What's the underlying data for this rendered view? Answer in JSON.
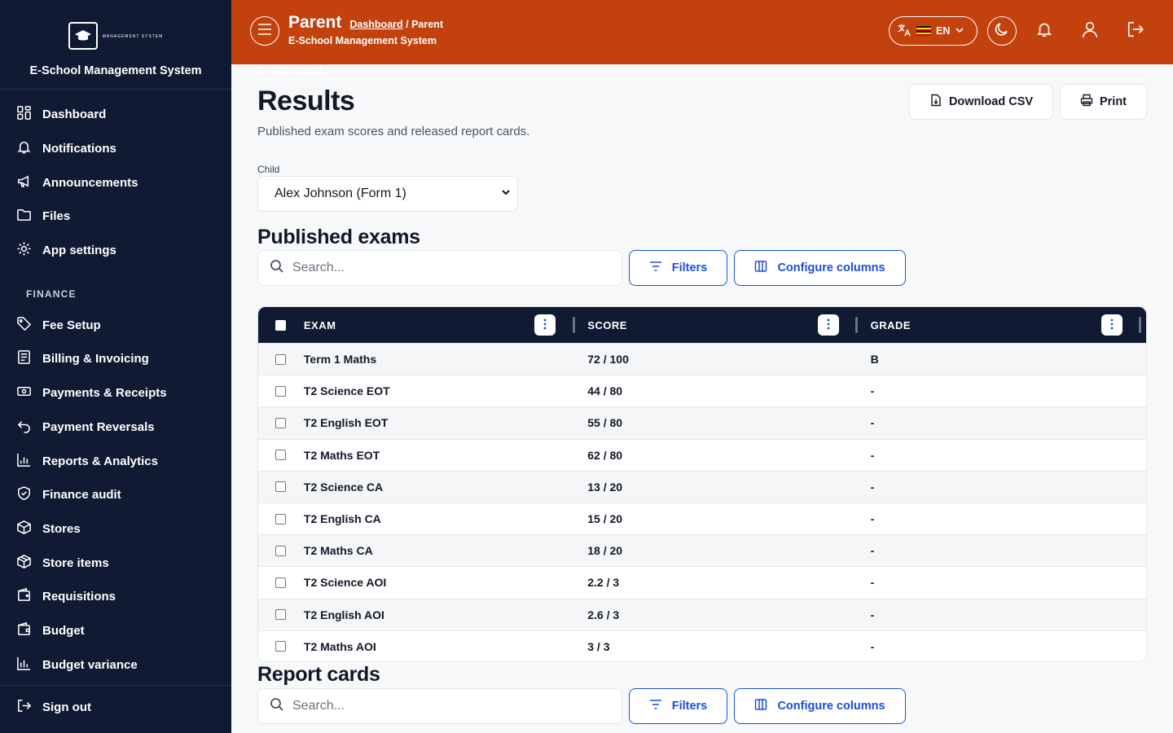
{
  "sidebar": {
    "logo_main": "E-SCHOOL",
    "logo_sub": "MANAGEMENT SYSTEM",
    "brand": "E-School Management System",
    "items": [
      {
        "label": "Dashboard",
        "icon": "grid-icon"
      },
      {
        "label": "Notifications",
        "icon": "bell-icon"
      },
      {
        "label": "Announcements",
        "icon": "megaphone-icon"
      },
      {
        "label": "Files",
        "icon": "folder-icon"
      },
      {
        "label": "App settings",
        "icon": "gear-icon"
      }
    ],
    "finance_heading": "FINANCE",
    "finance_items": [
      {
        "label": "Fee Setup",
        "icon": "tag-icon"
      },
      {
        "label": "Billing & Invoicing",
        "icon": "invoice-icon"
      },
      {
        "label": "Payments & Receipts",
        "icon": "cash-icon"
      },
      {
        "label": "Payment Reversals",
        "icon": "undo-icon"
      },
      {
        "label": "Reports & Analytics",
        "icon": "bar-chart-icon"
      },
      {
        "label": "Finance audit",
        "icon": "shield-check-icon"
      },
      {
        "label": "Stores",
        "icon": "box-icon"
      },
      {
        "label": "Store items",
        "icon": "package-icon"
      },
      {
        "label": "Requisitions",
        "icon": "wallet-icon"
      },
      {
        "label": "Budget",
        "icon": "budget-wallet-icon"
      },
      {
        "label": "Budget variance",
        "icon": "bar-chart-icon"
      }
    ],
    "sign_out": "Sign out"
  },
  "header": {
    "role": "Parent",
    "breadcrumb_link": "Dashboard",
    "breadcrumb_sep": " / ",
    "breadcrumb_current": "Parent",
    "subtitle": "E-School Management System",
    "lang": "EN"
  },
  "page": {
    "title": "Results",
    "description": "Published exam scores and released report cards.",
    "download_csv": "Download CSV",
    "print": "Print",
    "child_label": "Child",
    "child_value": "Alex Johnson (Form 1)"
  },
  "published": {
    "title": "Published exams",
    "search_placeholder": "Search...",
    "filters": "Filters",
    "configure": "Configure columns",
    "columns": [
      "EXAM",
      "SCORE",
      "GRADE"
    ],
    "rows": [
      {
        "exam": "Term 1 Maths",
        "score": "72 / 100",
        "grade": "B"
      },
      {
        "exam": "T2 Science EOT",
        "score": "44 / 80",
        "grade": "-"
      },
      {
        "exam": "T2 English EOT",
        "score": "55 / 80",
        "grade": "-"
      },
      {
        "exam": "T2 Maths EOT",
        "score": "62 / 80",
        "grade": "-"
      },
      {
        "exam": "T2 Science CA",
        "score": "13 / 20",
        "grade": "-"
      },
      {
        "exam": "T2 English CA",
        "score": "15 / 20",
        "grade": "-"
      },
      {
        "exam": "T2 Maths CA",
        "score": "18 / 20",
        "grade": "-"
      },
      {
        "exam": "T2 Science AOI",
        "score": "2.2 / 3",
        "grade": "-"
      },
      {
        "exam": "T2 English AOI",
        "score": "2.6 / 3",
        "grade": "-"
      },
      {
        "exam": "T2 Maths AOI",
        "score": "3 / 3",
        "grade": "-"
      }
    ]
  },
  "report_cards": {
    "title": "Report cards",
    "search_placeholder": "Search...",
    "filters": "Filters",
    "configure": "Configure columns"
  },
  "colors": {
    "sidebar_bg": "#101a33",
    "header_bg": "#c2410c",
    "accent_blue": "#1d4ed8"
  }
}
